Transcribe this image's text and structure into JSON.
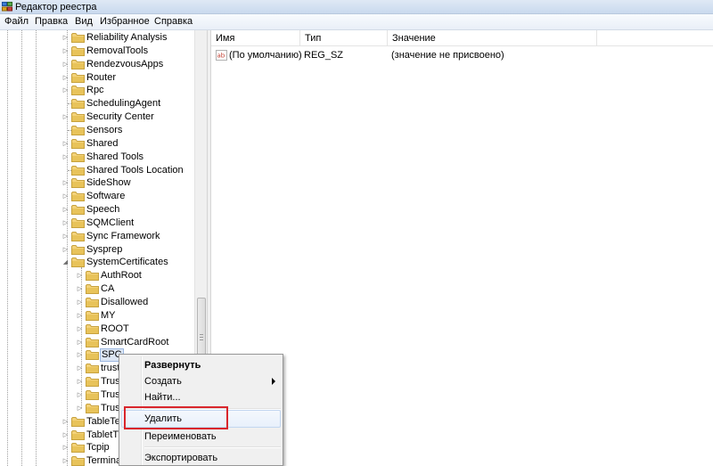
{
  "window": {
    "title": "Редактор реестра"
  },
  "menu": [
    "Файл",
    "Правка",
    "Вид",
    "Избранное",
    "Справка"
  ],
  "tree": {
    "items": [
      {
        "label": "Reliability Analysis",
        "expander": "▷"
      },
      {
        "label": "RemovalTools",
        "expander": "▷"
      },
      {
        "label": "RendezvousApps",
        "expander": "▷"
      },
      {
        "label": "Router",
        "expander": "▷"
      },
      {
        "label": "Rpc",
        "expander": "▷"
      },
      {
        "label": "SchedulingAgent",
        "expander": ""
      },
      {
        "label": "Security Center",
        "expander": "▷"
      },
      {
        "label": "Sensors",
        "expander": ""
      },
      {
        "label": "Shared",
        "expander": "▷"
      },
      {
        "label": "Shared Tools",
        "expander": "▷"
      },
      {
        "label": "Shared Tools Location",
        "expander": ""
      },
      {
        "label": "SideShow",
        "expander": "▷"
      },
      {
        "label": "Software",
        "expander": "▷"
      },
      {
        "label": "Speech",
        "expander": "▷"
      },
      {
        "label": "SQMClient",
        "expander": "▷"
      },
      {
        "label": "Sync Framework",
        "expander": "▷"
      },
      {
        "label": "Sysprep",
        "expander": "▷"
      },
      {
        "label": "SystemCertificates",
        "expander": "◢"
      }
    ],
    "children": [
      {
        "label": "AuthRoot",
        "expander": "▷"
      },
      {
        "label": "CA",
        "expander": "▷"
      },
      {
        "label": "Disallowed",
        "expander": "▷"
      },
      {
        "label": "MY",
        "expander": "▷"
      },
      {
        "label": "ROOT",
        "expander": "▷"
      },
      {
        "label": "SmartCardRoot",
        "expander": "▷"
      },
      {
        "label": "SPC",
        "expander": "▷"
      },
      {
        "label": "trust",
        "expander": "▷"
      },
      {
        "label": "Trus",
        "expander": "▷"
      },
      {
        "label": "Trus",
        "expander": "▷"
      },
      {
        "label": "Trus",
        "expander": "▷"
      }
    ],
    "after": [
      {
        "label": "TableTe",
        "expander": "▷"
      },
      {
        "label": "TabletTi",
        "expander": "▷"
      },
      {
        "label": "Tcpip",
        "expander": "▷"
      },
      {
        "label": "Termina",
        "expander": "▷"
      }
    ]
  },
  "list": {
    "columns": [
      "Имя",
      "Тип",
      "Значение"
    ],
    "rows": [
      {
        "name": "(По умолчанию)",
        "type": "REG_SZ",
        "value": "(значение не присвоено)"
      }
    ]
  },
  "context_menu": {
    "items": [
      {
        "label": "Развернуть",
        "bold": true
      },
      {
        "label": "Создать",
        "submenu": true
      },
      {
        "label": "Найти..."
      },
      {
        "label": "Удалить",
        "highlighted": true
      },
      {
        "label": "Переименовать"
      },
      {
        "label": "Экспортировать"
      }
    ]
  },
  "colors": {
    "folder": "#e8c35a",
    "highlight_box": "#d9262c",
    "selection": "#dce6f4"
  }
}
